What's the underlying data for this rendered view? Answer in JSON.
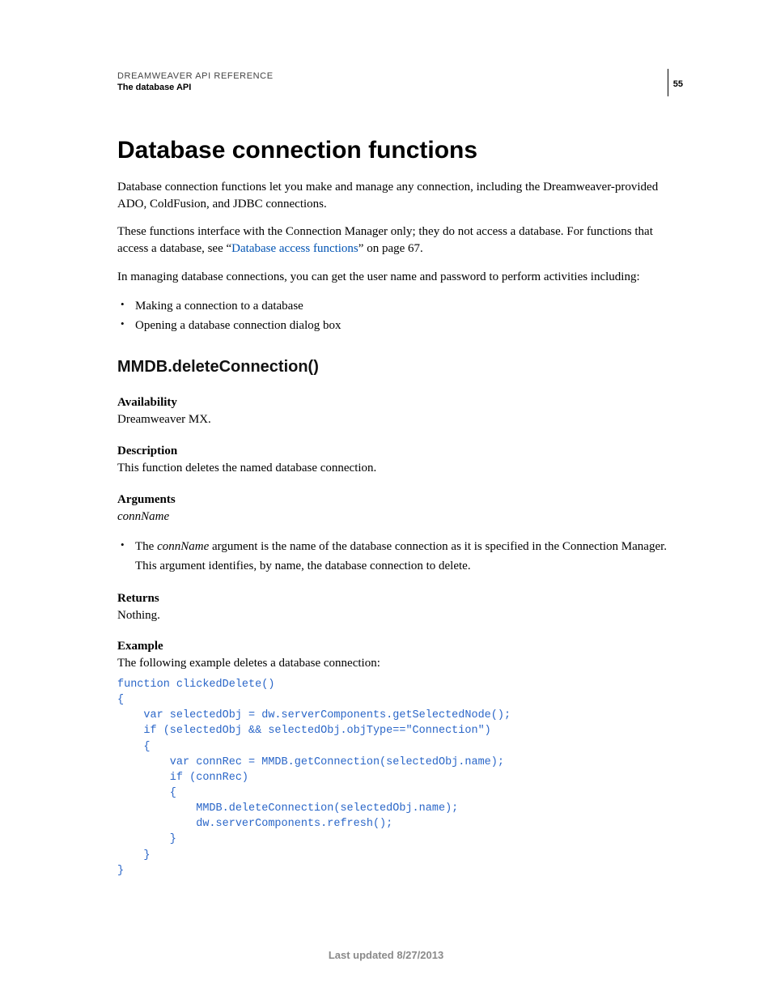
{
  "header": {
    "reference": "DREAMWEAVER API REFERENCE",
    "chapter": "The database API",
    "page_number": "55"
  },
  "section": {
    "title": "Database connection functions",
    "intro1": "Database connection functions let you make and manage any connection, including the Dreamweaver-provided ADO, ColdFusion, and JDBC connections.",
    "intro2_pre": "These functions interface with the Connection Manager only; they do not access a database. For functions that access a database, see “",
    "intro2_link": "Database access functions",
    "intro2_post": "” on page 67.",
    "intro3": "In managing database connections, you can get the user name and password to perform activities including:",
    "bullets": [
      "Making a connection to a database",
      "Opening a database connection dialog box"
    ]
  },
  "api": {
    "name": "MMDB.deleteConnection()",
    "availability_h": "Availability",
    "availability": "Dreamweaver MX.",
    "description_h": "Description",
    "description": "This function deletes the named database connection.",
    "arguments_h": "Arguments",
    "arguments_sig": "connName",
    "arg_bullet_pre": "The ",
    "arg_bullet_em": "connName",
    "arg_bullet_post": " argument is the name of the database connection as it is specified in the Connection Manager. This argument identifies, by name, the database connection to delete.",
    "returns_h": "Returns",
    "returns": "Nothing.",
    "example_h": "Example",
    "example_intro": "The following example deletes a database connection:",
    "code": "function clickedDelete() \n{ \n    var selectedObj = dw.serverComponents.getSelectedNode(); \n    if (selectedObj && selectedObj.objType==\"Connection\") \n    { \n        var connRec = MMDB.getConnection(selectedObj.name); \n        if (connRec) \n        { \n            MMDB.deleteConnection(selectedObj.name); \n            dw.serverComponents.refresh(); \n        } \n    } \n}"
  },
  "footer": {
    "updated": "Last updated 8/27/2013"
  }
}
